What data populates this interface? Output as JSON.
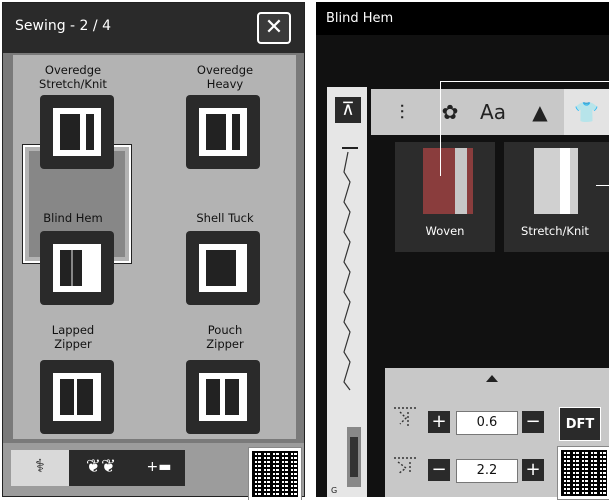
{
  "left_panel": {
    "title": "Sewing - 2 / 4",
    "close_symbol": "✕",
    "items": [
      {
        "label_line1": "Overedge",
        "label_line2": "Stretch/Knit",
        "icon": "overedge-stretch-knit-icon"
      },
      {
        "label_line1": "Overedge",
        "label_line2": "Heavy",
        "icon": "overedge-heavy-icon"
      },
      {
        "label_line1": "Blind Hem",
        "label_line2": "",
        "icon": "blind-hem-icon",
        "selected": true
      },
      {
        "label_line1": "Shell Tuck",
        "label_line2": "",
        "icon": "shell-tuck-icon"
      },
      {
        "label_line1": "Lapped",
        "label_line2": "Zipper",
        "icon": "lapped-zipper-icon"
      },
      {
        "label_line1": "Pouch",
        "label_line2": "Zipper",
        "icon": "pouch-zipper-icon"
      }
    ],
    "bottom_tabs": [
      {
        "name": "utility-stitch-tab",
        "symbol": "⚕"
      },
      {
        "name": "decorative-stitch-tab",
        "symbol": "❦❦"
      },
      {
        "name": "combine-tab",
        "symbol": "+▬"
      }
    ]
  },
  "right_panel": {
    "title": "Blind Hem",
    "side_top_symbol": "⊼",
    "foot_letter": "G",
    "category_tabs": [
      {
        "name": "stitch-category-tab",
        "symbol": "⫶"
      },
      {
        "name": "embroidery-category-tab",
        "symbol": "✿"
      },
      {
        "name": "font-category-tab",
        "symbol": "Aa"
      },
      {
        "name": "quilt-category-tab",
        "symbol": "▲"
      },
      {
        "name": "apparel-category-tab",
        "symbol": "👕"
      }
    ],
    "fabric_options": [
      "Woven",
      "Stretch/Knit"
    ],
    "settings": {
      "width_value": "0.6",
      "length_value": "2.2",
      "plus": "+",
      "minus": "−",
      "default_label": "DFT"
    }
  },
  "colors": {
    "panel_gray": "#7a7a7a",
    "grid_gray": "#b3b3b3",
    "dark": "#2a2a2a",
    "fabric_red": "#8a3d3d"
  }
}
